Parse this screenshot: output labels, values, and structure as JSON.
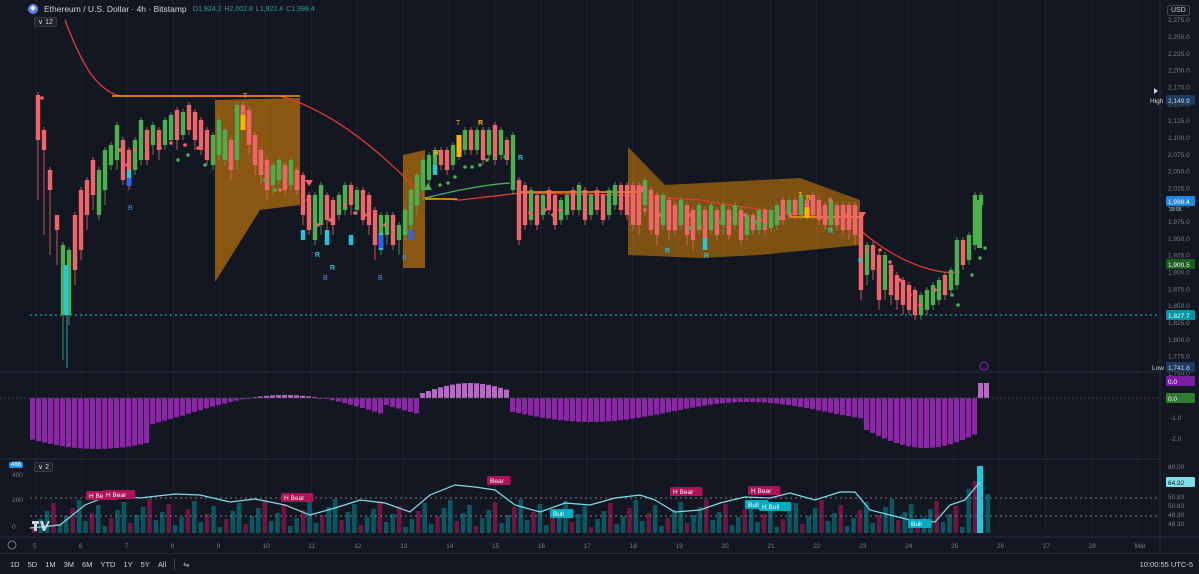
{
  "header": {
    "symbol_icon": "ethereum-icon",
    "symbol_glyph": "◆",
    "title": "Ethereum / U.S. Dollar · 4h · Bitstamp",
    "ohlc": [
      {
        "k": "O",
        "v": "1,924.2"
      },
      {
        "k": "H",
        "v": "2,002.8"
      },
      {
        "k": "L",
        "v": "1,922.4"
      },
      {
        "k": "C",
        "v": "1,998.4"
      }
    ],
    "indicator_count": "∨ 12",
    "currency": "USD"
  },
  "price_axis": {
    "ticks": [
      "2,275.0",
      "2,250.0",
      "2,225.0",
      "2,200.0",
      "2,175.0",
      "2,150.0",
      "2,125.0",
      "2,100.0",
      "2,075.0",
      "2,050.0",
      "2,025.0",
      "2,000.0",
      "1,975.0",
      "1,950.0",
      "1,925.0",
      "1,900.0",
      "1,875.0",
      "1,850.0",
      "1,825.0",
      "1,800.0",
      "1,775.0",
      "1,750.0"
    ],
    "high_label": "High",
    "high_value": "2,149.9",
    "low_label": "Low",
    "low_value": "1,741.8",
    "last_price": "1,998.4",
    "last_sub": "39:05",
    "ma_value": "1,900.5",
    "support_value": "1,827.7"
  },
  "oscillator_axis": {
    "ticks": [
      "0.0",
      "-1.0",
      "-2.0"
    ],
    "badge_a": "0.0",
    "badge_b": "0.0"
  },
  "rsi_axis": {
    "ticks": [
      "80.00",
      "64.92",
      "50.83",
      "50.83",
      "48.30",
      "48.30"
    ],
    "left_ticks": [
      "400",
      "200",
      "0"
    ],
    "indicator_badge": "488",
    "indicator_count": "∨ 2"
  },
  "time_axis": [
    "5",
    "6",
    "7",
    "8",
    "9",
    "10",
    "11",
    "12",
    "13",
    "14",
    "15",
    "16",
    "17",
    "18",
    "19",
    "20",
    "21",
    "22",
    "23",
    "24",
    "25",
    "26",
    "27",
    "28",
    "Mar"
  ],
  "annotations": {
    "hbear": [
      "H Bear",
      "H Bear",
      "H Bear",
      "Bear",
      "H Bear",
      "H Bear"
    ],
    "bull": [
      "Bull",
      "Bull",
      "H Bull",
      "Bull"
    ],
    "letters_b": [
      "B",
      "B",
      "B",
      "B"
    ],
    "letters_r": [
      "R",
      "R",
      "R",
      "R",
      "R",
      "R",
      "R",
      "R",
      "R",
      "R"
    ],
    "letters_t": [
      "T",
      "T",
      "T"
    ]
  },
  "bottom_bar": {
    "ranges": [
      "1D",
      "5D",
      "1M",
      "3M",
      "6M",
      "YTD",
      "1Y",
      "5Y",
      "All"
    ],
    "compare_icon": "calendar-range-icon",
    "time": "10:00:55 UTC-5"
  },
  "colors": {
    "bg": "#131722",
    "bull": "#4caf50",
    "bear": "#f06569",
    "teal": "#26c6da",
    "orange": "#ff9800",
    "ma": "#e53935",
    "purple": "#9c27b0",
    "grid": "#1e222d"
  }
}
